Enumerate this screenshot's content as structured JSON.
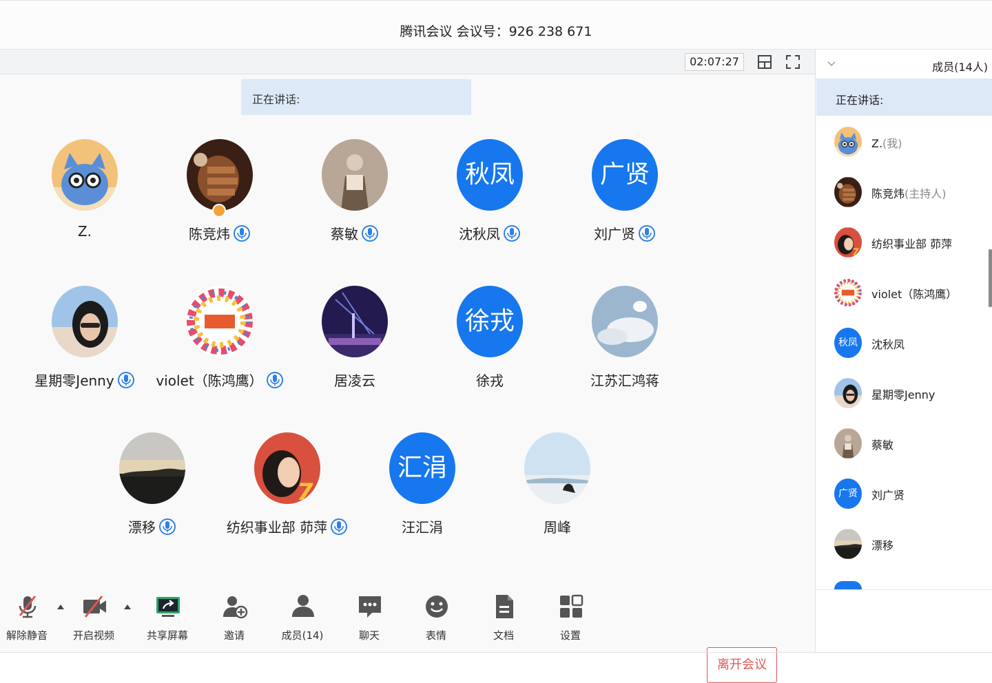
{
  "window": {
    "title": "腾讯会议 会议号：926 238 671"
  },
  "topbar": {
    "timer": "02:07:27",
    "layout_icon": "layout-icon",
    "fullscreen_icon": "fullscreen-icon"
  },
  "stage": {
    "speaking_label": "正在讲话:",
    "participants": [
      {
        "name": "Z.",
        "avatar": "cat",
        "mic": false
      },
      {
        "name": "陈竞炜",
        "avatar": "hand",
        "mic": true,
        "host": true
      },
      {
        "name": "蔡敏",
        "avatar": "figure",
        "mic": true
      },
      {
        "name": "沈秋凤",
        "avatar_text": "秋凤",
        "mic": true
      },
      {
        "name": "刘广贤",
        "avatar_text": "广贤",
        "mic": true
      },
      {
        "name": "星期零Jenny",
        "avatar": "woman",
        "mic": true
      },
      {
        "name": "violet（陈鸿鹰）",
        "avatar": "wreath",
        "mic": true
      },
      {
        "name": "居凌云",
        "avatar": "night",
        "mic": false
      },
      {
        "name": "徐戎",
        "avatar_text": "徐戎",
        "mic": false
      },
      {
        "name": "江苏汇鸿蒋",
        "avatar": "cloud",
        "mic": false
      },
      {
        "name": "漂移",
        "avatar": "sunset",
        "mic": true
      },
      {
        "name": "纺织事业部 茆萍",
        "avatar": "portrait",
        "mic": true
      },
      {
        "name": "汪汇涓",
        "avatar_text": "汇涓",
        "mic": false
      },
      {
        "name": "周峰",
        "avatar": "beach",
        "mic": false
      }
    ]
  },
  "toolbar": {
    "items": [
      {
        "label": "解除静音",
        "icon": "mic-muted-icon"
      },
      {
        "label": "开启视频",
        "icon": "video-off-icon"
      },
      {
        "label": "共享屏幕",
        "icon": "share-screen-icon"
      },
      {
        "label": "邀请",
        "icon": "invite-icon"
      },
      {
        "label": "成员(14)",
        "icon": "members-icon"
      },
      {
        "label": "聊天",
        "icon": "chat-icon"
      },
      {
        "label": "表情",
        "icon": "emoji-icon"
      },
      {
        "label": "文档",
        "icon": "document-icon"
      },
      {
        "label": "设置",
        "icon": "settings-icon"
      }
    ],
    "leave_label": "离开会议"
  },
  "sidebar": {
    "member_count": "成员(14人)",
    "speaking_label": "正在讲话:",
    "members": [
      {
        "name": "Z.",
        "role": "(我)",
        "avatar": "cat"
      },
      {
        "name": "陈竞炜",
        "role": "(主持人)",
        "avatar": "hand"
      },
      {
        "name": "纺织事业部 茆萍",
        "role": "",
        "avatar": "portrait"
      },
      {
        "name": "violet（陈鸿鹰）",
        "role": "",
        "avatar": "wreath"
      },
      {
        "name": "沈秋凤",
        "role": "",
        "avatar_text": "秋凤"
      },
      {
        "name": "星期零Jenny",
        "role": "",
        "avatar": "woman"
      },
      {
        "name": "蔡敏",
        "role": "",
        "avatar": "figure"
      },
      {
        "name": "刘广贤",
        "role": "",
        "avatar_text": "广贤"
      },
      {
        "name": "漂移",
        "role": "",
        "avatar": "sunset"
      }
    ]
  },
  "colors": {
    "accent": "#1677ee",
    "leave": "#e05656",
    "speaking_bg": "#dde9f7"
  }
}
